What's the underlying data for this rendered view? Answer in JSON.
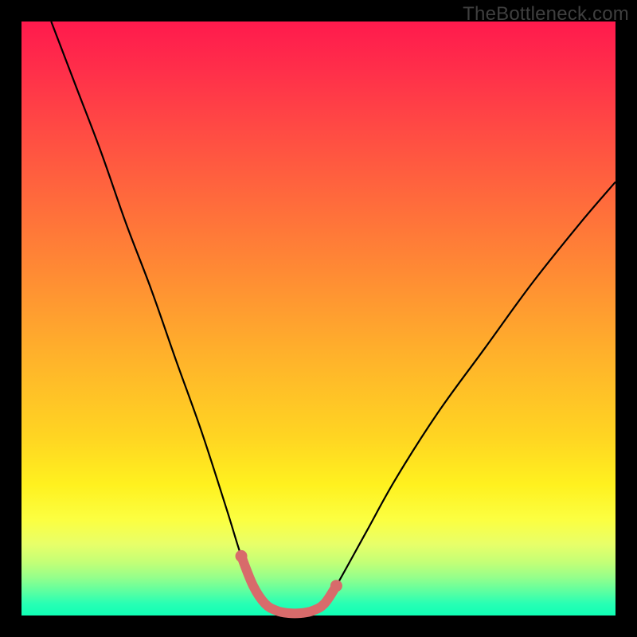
{
  "watermark": "TheBottleneck.com",
  "colors": {
    "frame": "#000000",
    "curve": "#000000",
    "accent_stroke": "#d86b6b",
    "accent_dot": "#d86b6b",
    "gradient_top": "#ff1a4d",
    "gradient_mid": "#ffd522",
    "gradient_bottom": "#10ffb5"
  },
  "chart_data": {
    "type": "line",
    "title": "",
    "xlabel": "",
    "ylabel": "",
    "xlim": [
      0,
      100
    ],
    "ylim": [
      0,
      100
    ],
    "grid": false,
    "x": [
      5.0,
      9.2,
      13.4,
      17.6,
      21.8,
      26.0,
      30.3,
      34.5,
      37.0,
      39.0,
      41.0,
      43.0,
      45.0,
      47.0,
      49.0,
      51.0,
      53.0,
      58.0,
      63.0,
      70.0,
      78.0,
      86.0,
      94.0,
      100.0
    ],
    "values": [
      100.0,
      89.0,
      78.0,
      66.0,
      55.0,
      43.0,
      31.0,
      18.0,
      10.0,
      5.0,
      2.0,
      0.8,
      0.4,
      0.4,
      0.8,
      2.0,
      5.0,
      14.0,
      23.0,
      34.0,
      45.0,
      56.0,
      66.0,
      73.0
    ],
    "accent_points_x": [
      37.0,
      39.0,
      41.0,
      43.0,
      45.0,
      47.0,
      49.0,
      51.0,
      53.0
    ],
    "accent_points_y": [
      10.0,
      5.0,
      2.0,
      0.8,
      0.4,
      0.4,
      0.8,
      2.0,
      5.0
    ]
  }
}
